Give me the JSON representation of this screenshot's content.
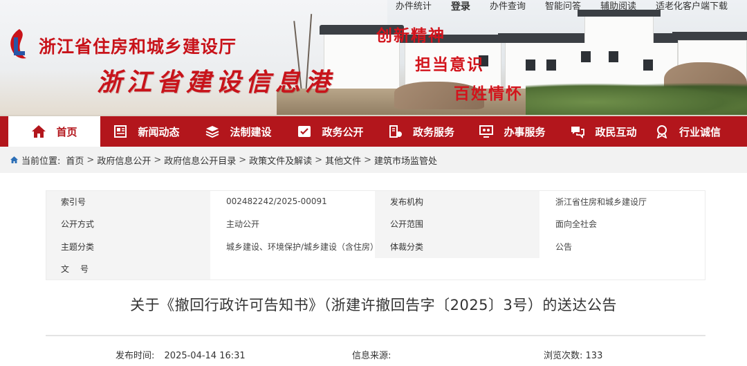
{
  "header": {
    "org_name": "浙江省住房和城乡建设厅",
    "portal_name": "浙江省建设信息港",
    "slogans": [
      "创新精神",
      "担当意识",
      "百姓情怀"
    ]
  },
  "top_links": [
    "办件统计",
    "登录",
    "办件查询",
    "智能问答",
    "辅助阅读",
    "适老化客户端下载"
  ],
  "nav": [
    {
      "label": "首页",
      "icon": "home-icon",
      "active": true
    },
    {
      "label": "新闻动态",
      "icon": "newspaper-icon"
    },
    {
      "label": "法制建设",
      "icon": "layers-icon"
    },
    {
      "label": "政务公开",
      "icon": "checklist-icon"
    },
    {
      "label": "政务服务",
      "icon": "service-icon"
    },
    {
      "label": "办事服务",
      "icon": "monitor-people-icon"
    },
    {
      "label": "政民互动",
      "icon": "chat-icon"
    },
    {
      "label": "行业诚信",
      "icon": "award-icon"
    }
  ],
  "breadcrumb": {
    "prefix": "当前位置:",
    "items": [
      "首页",
      "政府信息公开",
      "政府信息公开目录",
      "政策文件及解读",
      "其他文件",
      "建筑市场监管处"
    ],
    "separator": ">"
  },
  "info": [
    {
      "label1": "索引号",
      "value1": "002482242/2025-00091",
      "label2": "发布机构",
      "value2": "浙江省住房和城乡建设厅"
    },
    {
      "label1": "公开方式",
      "value1": "主动公开",
      "label2": "公开范围",
      "value2": "面向全社会"
    },
    {
      "label1": "主题分类",
      "value1": "城乡建设、环境保护/城乡建设（含住房）",
      "label2": "体裁分类",
      "value2": "公告"
    },
    {
      "label1": "文号",
      "value1": "",
      "label2": "",
      "value2": ""
    }
  ],
  "document": {
    "title": "关于《撤回行政许可告知书》（浙建许撤回告字〔2025〕3号）的送达公告",
    "publish_time_label": "发布时间:",
    "publish_time": "2025-04-14 16:31",
    "source_label": "信息来源:",
    "source": "",
    "views_label": "浏览次数:",
    "views": "133"
  },
  "colors": {
    "brand_red": "#b3161c",
    "title_red": "#c8131a"
  }
}
